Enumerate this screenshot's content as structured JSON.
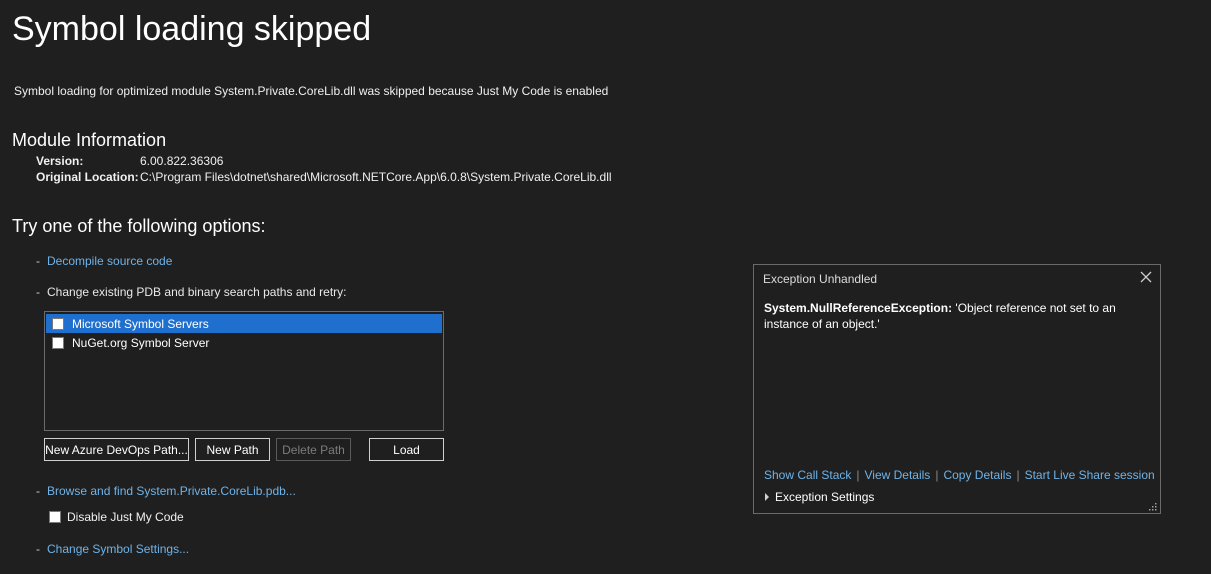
{
  "title": "Symbol loading skipped",
  "subtitle": "Symbol loading for optimized module System.Private.CoreLib.dll was skipped because Just My Code is enabled",
  "module_info": {
    "heading": "Module Information",
    "version_label": "Version:",
    "version_value": "6.00.822.36306",
    "location_label": "Original Location:",
    "location_value": "C:\\Program Files\\dotnet\\shared\\Microsoft.NETCore.App\\6.0.8\\System.Private.CoreLib.dll"
  },
  "options": {
    "heading": "Try one of the following options:",
    "dash": "-",
    "decompile": "Decompile source code",
    "change_paths": "Change existing PDB and binary search paths and retry:",
    "browse": "Browse and find System.Private.CoreLib.pdb...",
    "disable_jmc": "Disable Just My Code",
    "change_settings": "Change Symbol Settings..."
  },
  "symbol_servers": [
    {
      "label": "Microsoft Symbol Servers",
      "checked": false,
      "selected": true
    },
    {
      "label": "NuGet.org Symbol Server",
      "checked": false,
      "selected": false
    }
  ],
  "buttons": {
    "new_azure": "New Azure DevOps Path...",
    "new_path": "New Path",
    "delete_path": "Delete Path",
    "load": "Load"
  },
  "exception": {
    "title": "Exception Unhandled",
    "type": "System.NullReferenceException:",
    "message": " 'Object reference not set to an instance of an object.'",
    "links": [
      "Show Call Stack",
      "View Details",
      "Copy Details",
      "Start Live Share session"
    ],
    "separator": "|",
    "settings": "Exception Settings"
  },
  "colors": {
    "background": "#1f1f1f",
    "link": "#6fb3e8",
    "selection": "#1f6fce"
  }
}
